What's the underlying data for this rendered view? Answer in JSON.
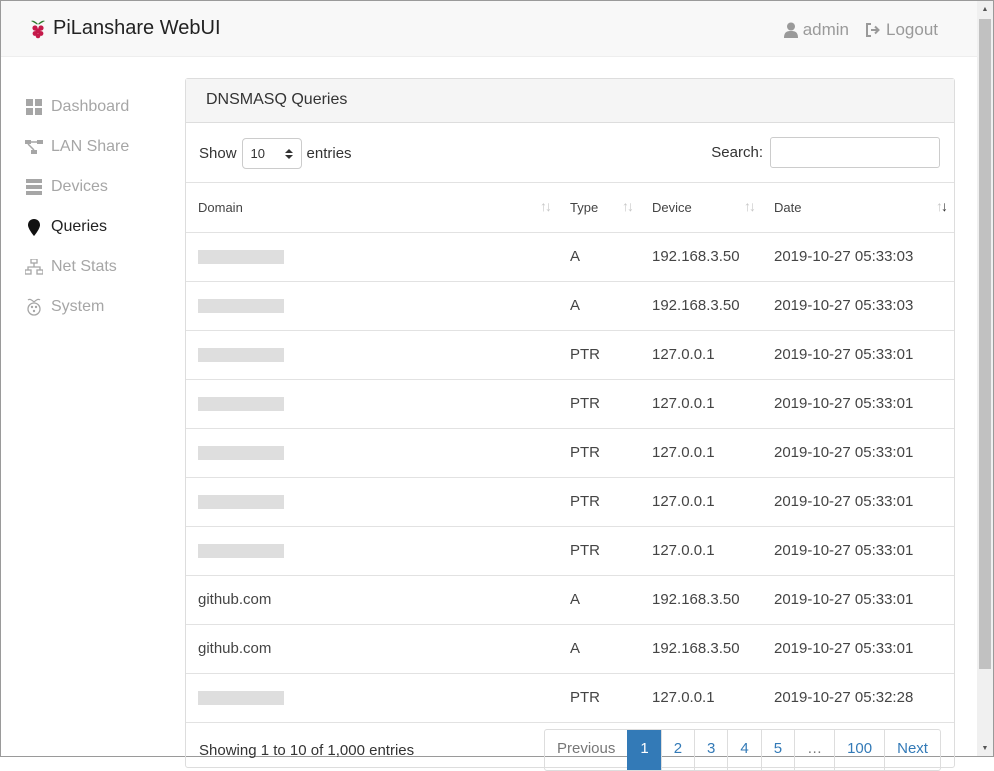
{
  "navbar": {
    "brand": "PiLanshare WebUI",
    "user_label": "admin",
    "logout_label": "Logout"
  },
  "sidebar": {
    "items": [
      {
        "label": "Dashboard",
        "icon": "dashboard-icon",
        "active": false
      },
      {
        "label": "LAN Share",
        "icon": "share-icon",
        "active": false
      },
      {
        "label": "Devices",
        "icon": "server-icon",
        "active": false
      },
      {
        "label": "Queries",
        "icon": "map-marker-icon",
        "active": true
      },
      {
        "label": "Net Stats",
        "icon": "network-icon",
        "active": false
      },
      {
        "label": "System",
        "icon": "raspberry-icon",
        "active": false
      }
    ]
  },
  "panel": {
    "title": "DNSMASQ Queries",
    "show_label": "Show",
    "entries_value": "10",
    "entries_label": "entries",
    "search_label": "Search:",
    "search_value": "",
    "columns": [
      "Domain",
      "Type",
      "Device",
      "Date"
    ],
    "rows": [
      {
        "domain": "",
        "redacted": true,
        "type": "A",
        "device": "192.168.3.50",
        "date": "2019-10-27 05:33:03"
      },
      {
        "domain": "",
        "redacted": true,
        "type": "A",
        "device": "192.168.3.50",
        "date": "2019-10-27 05:33:03"
      },
      {
        "domain": "",
        "redacted": true,
        "type": "PTR",
        "device": "127.0.0.1",
        "date": "2019-10-27 05:33:01"
      },
      {
        "domain": "",
        "redacted": true,
        "type": "PTR",
        "device": "127.0.0.1",
        "date": "2019-10-27 05:33:01"
      },
      {
        "domain": "",
        "redacted": true,
        "type": "PTR",
        "device": "127.0.0.1",
        "date": "2019-10-27 05:33:01"
      },
      {
        "domain": "",
        "redacted": true,
        "type": "PTR",
        "device": "127.0.0.1",
        "date": "2019-10-27 05:33:01"
      },
      {
        "domain": "",
        "redacted": true,
        "type": "PTR",
        "device": "127.0.0.1",
        "date": "2019-10-27 05:33:01"
      },
      {
        "domain": "github.com",
        "redacted": false,
        "type": "A",
        "device": "192.168.3.50",
        "date": "2019-10-27 05:33:01"
      },
      {
        "domain": "github.com",
        "redacted": false,
        "type": "A",
        "device": "192.168.3.50",
        "date": "2019-10-27 05:33:01"
      },
      {
        "domain": "",
        "redacted": true,
        "type": "PTR",
        "device": "127.0.0.1",
        "date": "2019-10-27 05:32:28"
      }
    ],
    "info": "Showing 1 to 10 of 1,000 entries",
    "pagination": [
      "Previous",
      "1",
      "2",
      "3",
      "4",
      "5",
      "…",
      "100",
      "Next"
    ],
    "current_page": "1"
  },
  "colors": {
    "accent": "#337ab7",
    "redaction": "#dedede"
  }
}
